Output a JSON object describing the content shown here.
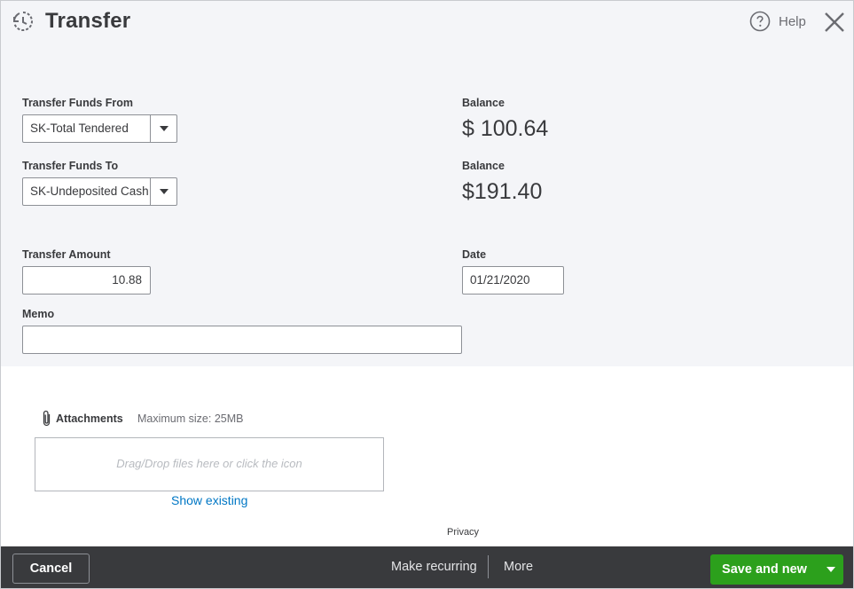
{
  "header": {
    "title": "Transfer",
    "help_label": "Help"
  },
  "form": {
    "from_label": "Transfer Funds From",
    "from_value": "SK-Total Tendered",
    "from_balance_label": "Balance",
    "from_balance": "$ 100.64",
    "to_label": "Transfer Funds To",
    "to_value": "SK-Undeposited Cash",
    "to_balance_label": "Balance",
    "to_balance": "$191.40",
    "amount_label": "Transfer Amount",
    "amount_value": "10.88",
    "date_label": "Date",
    "date_value": "01/21/2020",
    "memo_label": "Memo",
    "memo_value": ""
  },
  "attachments": {
    "label": "Attachments",
    "max_size": "Maximum size: 25MB",
    "dropzone_text": "Drag/Drop files here or click the icon",
    "show_existing": "Show existing"
  },
  "privacy_link": "Privacy",
  "footer": {
    "cancel_label": "Cancel",
    "make_recurring_label": "Make recurring",
    "more_label": "More",
    "save_label": "Save and new"
  },
  "colors": {
    "accent_green": "#2ca01c",
    "link_blue": "#0077c5",
    "footer_bg": "#393a3d",
    "form_bg": "#f4f5f8"
  },
  "icons": {
    "title": "transfer-clock-icon",
    "help": "question-circle-icon",
    "close": "close-icon",
    "attach": "paperclip-icon",
    "dropdown": "caret-down-icon"
  }
}
